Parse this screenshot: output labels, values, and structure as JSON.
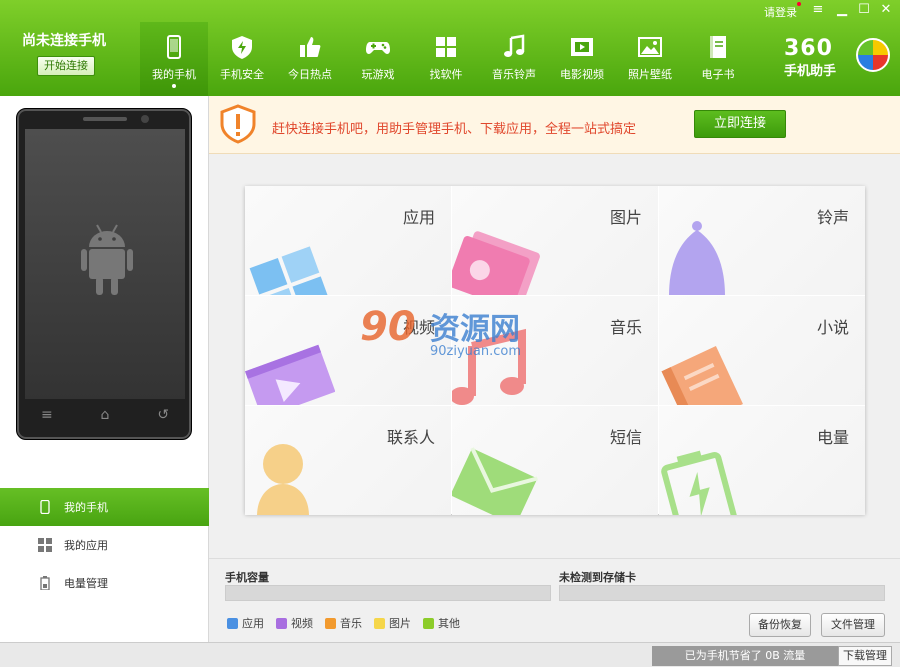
{
  "header": {
    "connection_status": "尚未连接手机",
    "connect_button": "开始连接",
    "login": "请登录",
    "logo_number": "360",
    "logo_name": "手机助手",
    "nav": [
      {
        "label": "我的手机",
        "icon": "phone-icon"
      },
      {
        "label": "手机安全",
        "icon": "shield-icon"
      },
      {
        "label": "今日热点",
        "icon": "thumbs-up-icon"
      },
      {
        "label": "玩游戏",
        "icon": "gamepad-icon"
      },
      {
        "label": "找软件",
        "icon": "apps-grid-icon"
      },
      {
        "label": "音乐铃声",
        "icon": "music-note-icon"
      },
      {
        "label": "电影视频",
        "icon": "film-icon"
      },
      {
        "label": "照片壁纸",
        "icon": "picture-icon"
      },
      {
        "label": "电子书",
        "icon": "book-icon"
      }
    ],
    "window_controls": {
      "menu": "≡",
      "minimize": "▁",
      "maximize": "☐",
      "close": "✕"
    }
  },
  "alert": {
    "message": "赶快连接手机吧，用助手管理手机、下载应用，全程一站式搞定",
    "button": "立即连接"
  },
  "sidebar": {
    "items": [
      {
        "label": "我的手机",
        "icon": "phone-icon"
      },
      {
        "label": "我的应用",
        "icon": "apps-grid-icon"
      },
      {
        "label": "电量管理",
        "icon": "battery-icon"
      }
    ]
  },
  "phone_keys": [
    "≡",
    "⌂",
    "↺"
  ],
  "grid": {
    "cells": [
      {
        "label": "应用",
        "icon": "apps-icon"
      },
      {
        "label": "图片",
        "icon": "picture-icon"
      },
      {
        "label": "铃声",
        "icon": "bell-icon"
      },
      {
        "label": "视频",
        "icon": "film-icon"
      },
      {
        "label": "音乐",
        "icon": "music-note-icon"
      },
      {
        "label": "小说",
        "icon": "book-icon"
      },
      {
        "label": "联系人",
        "icon": "contact-icon"
      },
      {
        "label": "短信",
        "icon": "envelope-icon"
      },
      {
        "label": "电量",
        "icon": "battery-icon"
      }
    ]
  },
  "watermark": {
    "number": "90",
    "text": "资源网",
    "sub": "90ziyuan.com"
  },
  "storage": {
    "phone_capacity_label": "手机容量",
    "sd_card_label": "未检测到存储卡",
    "legend": [
      {
        "label": "应用",
        "color": "#4a90e2"
      },
      {
        "label": "视频",
        "color": "#a86ee0"
      },
      {
        "label": "音乐",
        "color": "#f29a2e"
      },
      {
        "label": "图片",
        "color": "#f5d64a"
      },
      {
        "label": "其他",
        "color": "#8ccc2a"
      }
    ],
    "backup_button": "备份恢复",
    "file_button": "文件管理"
  },
  "status": {
    "saved": "已为手机节省了 0B 流量",
    "download_button": "下载管理"
  },
  "colors": {
    "brand_green": "#4aa60d",
    "alert_red": "#e0472c"
  }
}
